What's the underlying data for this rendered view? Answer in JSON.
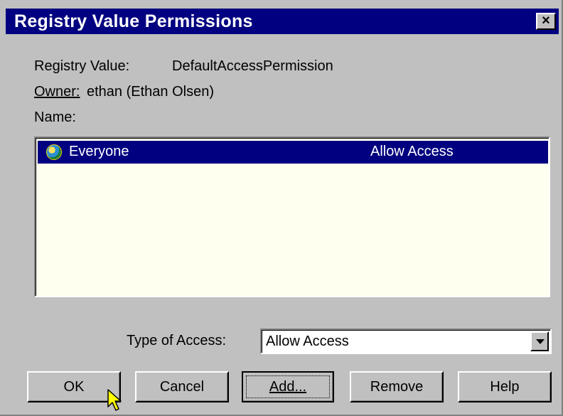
{
  "window": {
    "title": "Registry Value Permissions",
    "close_label": "×"
  },
  "info": {
    "registry_value_label": "Registry Value:",
    "registry_value": "DefaultAccessPermission",
    "owner_label": "Owner:",
    "owner_value": "ethan (Ethan Olsen)",
    "name_label": "Name:"
  },
  "list": {
    "items": [
      {
        "icon": "globe-icon",
        "name": "Everyone",
        "access": "Allow Access",
        "selected": true
      }
    ]
  },
  "access": {
    "label": "Type of Access:",
    "selected": "Allow Access"
  },
  "buttons": {
    "ok": "OK",
    "cancel": "Cancel",
    "add": "Add...",
    "remove": "Remove",
    "help": "Help"
  },
  "colors": {
    "titlebar": "#000080",
    "face": "#c0c0c0",
    "list_background": "#fffff0",
    "selection": "#000080",
    "cursor": "#ffff00"
  }
}
